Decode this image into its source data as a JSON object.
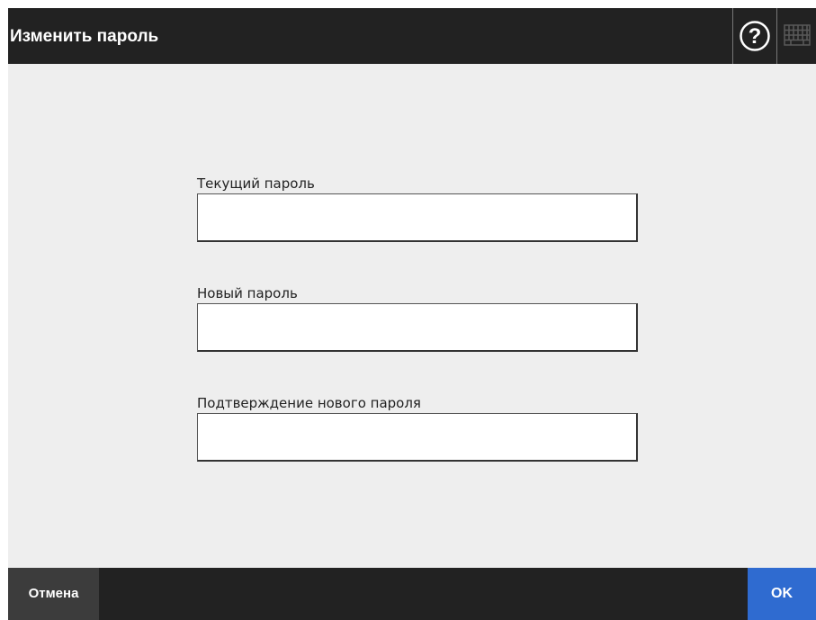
{
  "header": {
    "title": "Изменить пароль",
    "help_icon": "help-question-icon",
    "keyboard_icon": "keyboard-icon"
  },
  "form": {
    "current_password": {
      "label": "Текущий пароль",
      "value": ""
    },
    "new_password": {
      "label": "Новый пароль",
      "value": ""
    },
    "confirm_password": {
      "label": "Подтверждение нового пароля",
      "value": ""
    }
  },
  "footer": {
    "cancel_label": "Отмена",
    "ok_label": "OK"
  },
  "colors": {
    "header_bg": "#222222",
    "content_bg": "#eeeeee",
    "cancel_bg": "#3c3c3c",
    "ok_bg": "#2f6bd0"
  }
}
